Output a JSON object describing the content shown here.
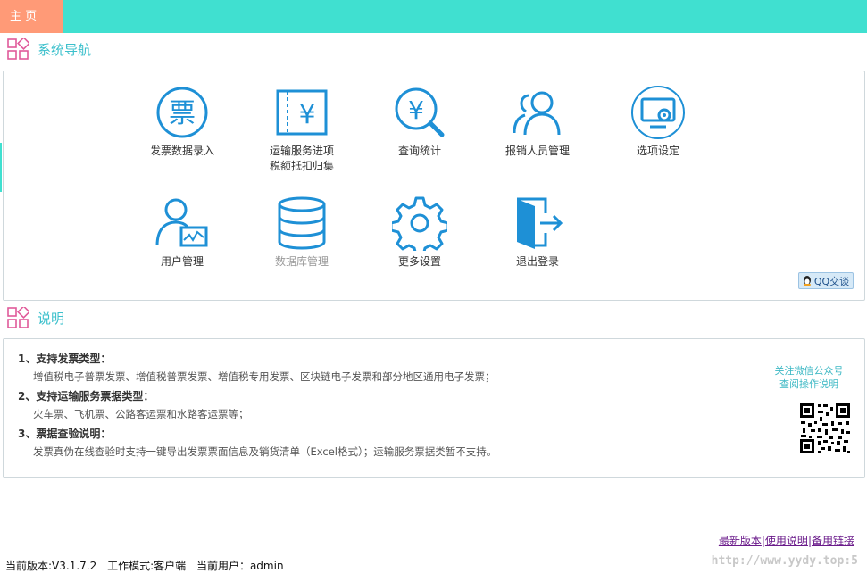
{
  "tabs": {
    "home": "主 页"
  },
  "nav_section": {
    "title": "系统导航"
  },
  "nav_items": [
    {
      "label": "发票数据录入",
      "icon": "invoice-ticket-icon",
      "enabled": true
    },
    {
      "label": "运输服务进项\n税额抵扣归集",
      "icon": "yuan-document-icon",
      "enabled": true
    },
    {
      "label": "查询统计",
      "icon": "yuan-search-icon",
      "enabled": true
    },
    {
      "label": "报销人员管理",
      "icon": "users-group-icon",
      "enabled": true
    },
    {
      "label": "选项设定",
      "icon": "monitor-settings-icon",
      "enabled": true
    },
    {
      "label": "用户管理",
      "icon": "user-monitor-icon",
      "enabled": true
    },
    {
      "label": "数据库管理",
      "icon": "database-icon",
      "enabled": false
    },
    {
      "label": "更多设置",
      "icon": "gear-icon",
      "enabled": true
    },
    {
      "label": "退出登录",
      "icon": "logout-door-icon",
      "enabled": true
    }
  ],
  "qq_button": "QQ交谈",
  "desc_section": {
    "title": "说明",
    "items": [
      {
        "heading": "1、支持发票类型：",
        "text": "增值税电子普票发票、增值税普票发票、增值税专用发票、区块链电子发票和部分地区通用电子发票；"
      },
      {
        "heading": "2、支持运输服务票据类型：",
        "text": "火车票、飞机票、公路客运票和水路客运票等；"
      },
      {
        "heading": "3、票据查验说明：",
        "text": "发票真伪在线查验时支持一键导出发票票面信息及销货清单（Excel格式）；运输服务票据类暂不支持。"
      }
    ]
  },
  "wechat": {
    "line1": "关注微信公众号",
    "line2": "查阅操作说明"
  },
  "links": {
    "latest": "最新版本",
    "manual": "使用说明",
    "backup": "备用链接",
    "sep": "|"
  },
  "status": {
    "version": "当前版本:V3.1.7.2",
    "mode": "工作模式:客户端",
    "user": "当前用户：admin"
  },
  "watermark": "http://www.yydy.top:5",
  "colors": {
    "accent": "#40e0d0",
    "home_tab": "#ff9a77",
    "icon": "#1e90d6",
    "title": "#3cc0cc"
  }
}
